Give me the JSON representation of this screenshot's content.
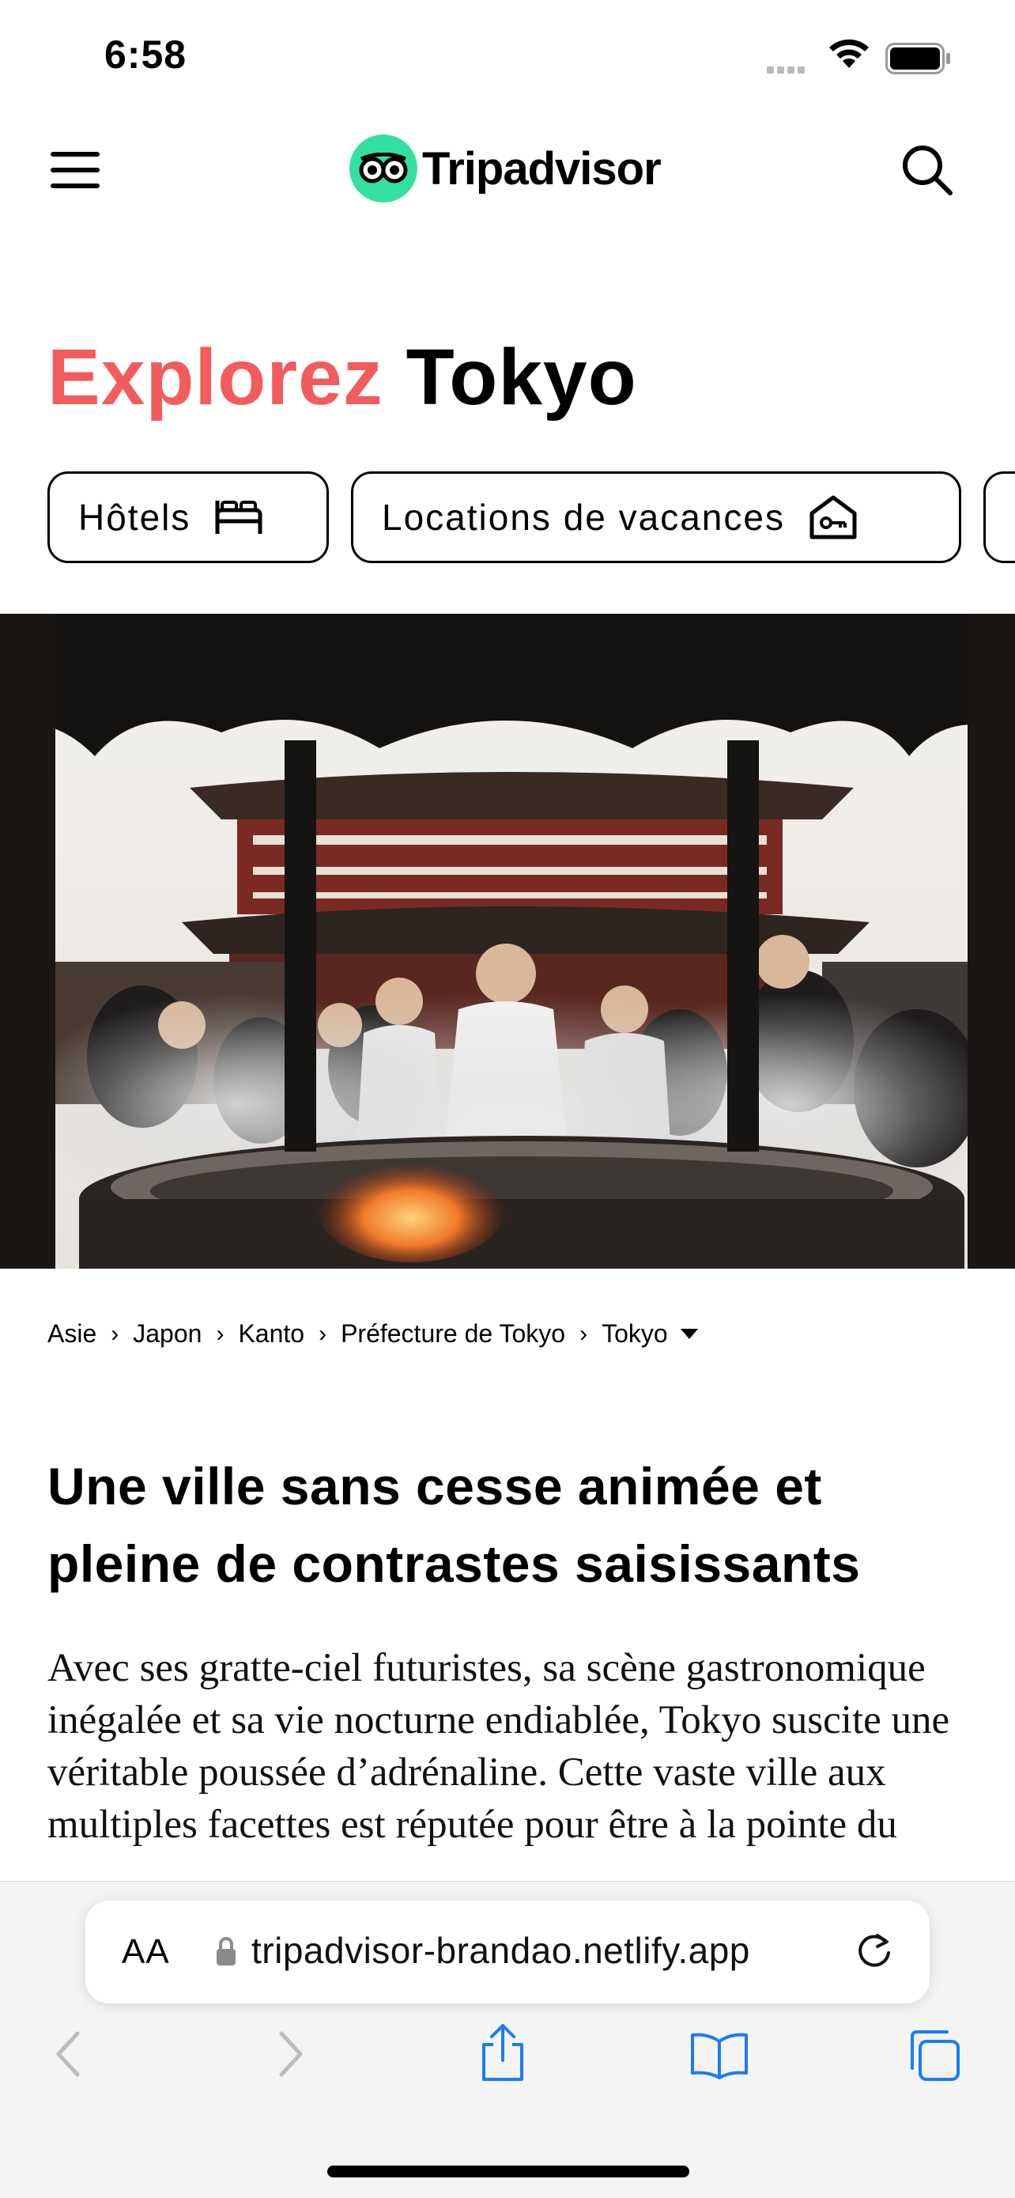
{
  "status_bar": {
    "time": "6:58"
  },
  "header": {
    "logo_text": "Tripadvisor"
  },
  "page": {
    "title_accent": "Explorez",
    "title_place": "Tokyo"
  },
  "chips": [
    {
      "label": "Hôtels",
      "icon": "bed-icon"
    },
    {
      "label": "Locations de vacances",
      "icon": "house-key-icon"
    }
  ],
  "breadcrumb": [
    "Asie",
    "Japon",
    "Kanto",
    "Préfecture de Tokyo",
    "Tokyo"
  ],
  "article": {
    "heading": "Une ville sans cesse animée et pleine de contrastes saisissants",
    "body": "Avec ses gratte-ciel futuristes, sa scène gastronomique inégalée et sa vie nocturne endiablée, Tokyo suscite une véritable poussée d’adrénaline. Cette vaste ville aux multiples facettes est réputée pour être à la pointe du"
  },
  "browser": {
    "text_size_label": "AA",
    "url": "tripadvisor-brandao.netlify.app"
  },
  "colors": {
    "accent": "#f25c5c",
    "brand_green": "#34e0a1",
    "safari_blue": "#1a7cf5"
  }
}
